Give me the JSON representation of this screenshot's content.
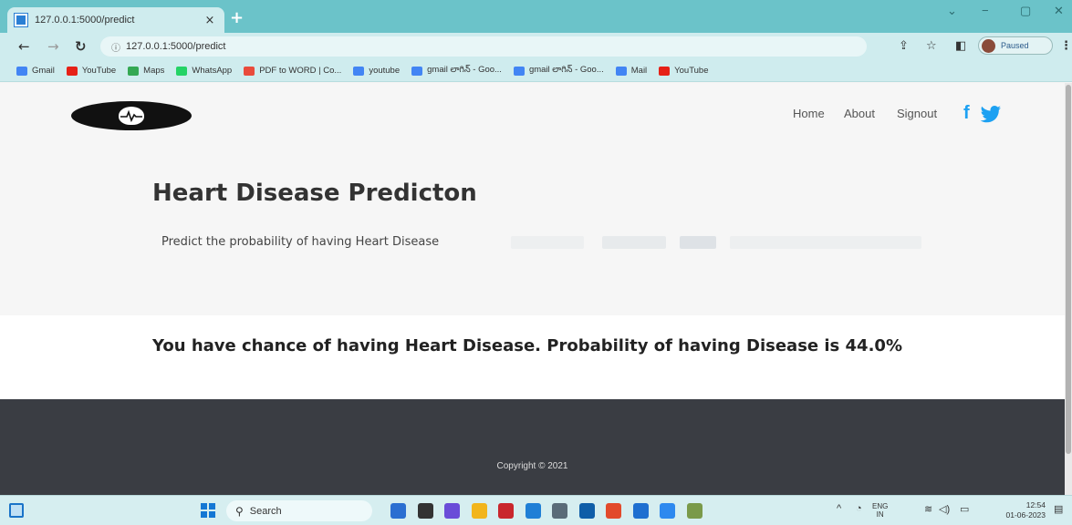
{
  "browser": {
    "tab_title": "127.0.0.1:5000/predict",
    "tab_close": "×",
    "new_tab": "+",
    "url": "127.0.0.1:5000/predict",
    "profile_status": "Paused",
    "window_controls": [
      "⌄",
      "−",
      "▢",
      "✕"
    ]
  },
  "bookmarks": [
    {
      "label": "Gmail",
      "color": "#4285f4"
    },
    {
      "label": "YouTube",
      "color": "#e62117"
    },
    {
      "label": "Maps",
      "color": "#34a853"
    },
    {
      "label": "WhatsApp",
      "color": "#25d366"
    },
    {
      "label": "PDF to WORD | Co...",
      "color": "#e94b3c"
    },
    {
      "label": "youtube",
      "color": "#4285f4"
    },
    {
      "label": "gmail లాగిన్ - Goo...",
      "color": "#4285f4"
    },
    {
      "label": "gmail లాగిన్ - Goo...",
      "color": "#4285f4"
    },
    {
      "label": "Mail",
      "color": "#4285f4"
    },
    {
      "label": "YouTube",
      "color": "#e62117"
    }
  ],
  "site": {
    "nav": [
      "Home",
      "About",
      "Signout"
    ],
    "social": [
      "facebook-icon",
      "twitter-icon"
    ],
    "hero_title": "Heart Disease Predicton",
    "hero_subtitle": "Predict the probability of having Heart Disease",
    "result_text": "You have chance of having Heart Disease. Probability of having Disease is 44.0%",
    "footer_copyright": "Copyright © 2021"
  },
  "taskbar": {
    "search_placeholder": "Search",
    "language": "ENG",
    "region": "IN",
    "time": "12:54",
    "date": "01-06-2023",
    "apps": [
      "#2b6fd1",
      "#333333",
      "#6a4cd8",
      "#f2b51b",
      "#c9262c",
      "#1f7fd6",
      "#5a6b78",
      "#0f5ea8",
      "#e24a2b",
      "#1e6fd0",
      "#2d89ef",
      "#7a9a4a"
    ]
  },
  "colors": {
    "tabstrip": "#6bc3c9",
    "toolbar": "#cfecee",
    "footer": "#3a3d43",
    "twitter": "#1da1f2"
  }
}
